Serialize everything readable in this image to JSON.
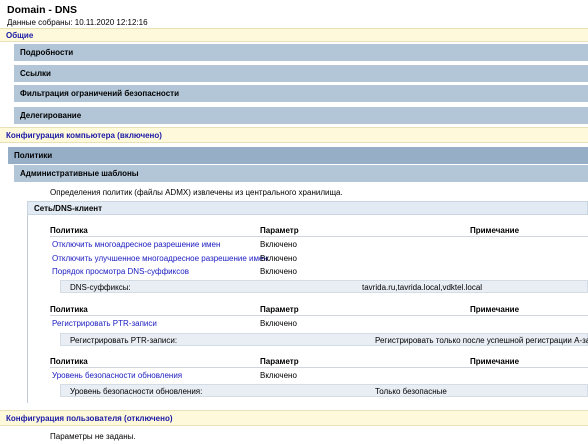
{
  "header": {
    "title": "Domain - DNS",
    "collected": "Данные собраны: 10.11.2020 12:12:16"
  },
  "sections": {
    "general": "Общие",
    "details": "Подробности",
    "links": "Ссылки",
    "security_filtering": "Фильтрация ограничений безопасности",
    "delegation": "Делегирование",
    "computer_config": "Конфигурация компьютера (включено)",
    "policies": "Политики",
    "admin_templates": "Административные шаблоны",
    "admx_note": "Определения политик (файлы ADMX) извлечены из центрального хранилища.",
    "network_dns_client": "Сеть/DNS-клиент",
    "user_config": "Конфигурация пользователя (отключено)",
    "user_config_note": "Параметры не заданы."
  },
  "columns": {
    "policy": "Политика",
    "setting": "Параметр",
    "comment": "Примечание"
  },
  "group1": {
    "rows": [
      {
        "name": "Отключить многоадресное разрешение имен",
        "value": "Включено"
      },
      {
        "name": "Отключить улучшенное многоадресное разрешение имен",
        "value": "Включено"
      },
      {
        "name": "Порядок просмотра DNS-суффиксов",
        "value": "Включено"
      }
    ],
    "detail_label": "DNS-суффиксы:",
    "detail_value": "tavrida.ru,tavrida.local,vdktel.local"
  },
  "group2": {
    "rows": [
      {
        "name": "Регистрировать PTR-записи",
        "value": "Включено"
      }
    ],
    "detail_label": "Регистрировать PTR-записи:",
    "detail_value": "Регистрировать только после успешной регистрации А-записи"
  },
  "group3": {
    "rows": [
      {
        "name": "Уровень безопасности обновления",
        "value": "Включено"
      }
    ],
    "detail_label": "Уровень безопасности обновления:",
    "detail_value": "Только безопасные"
  }
}
